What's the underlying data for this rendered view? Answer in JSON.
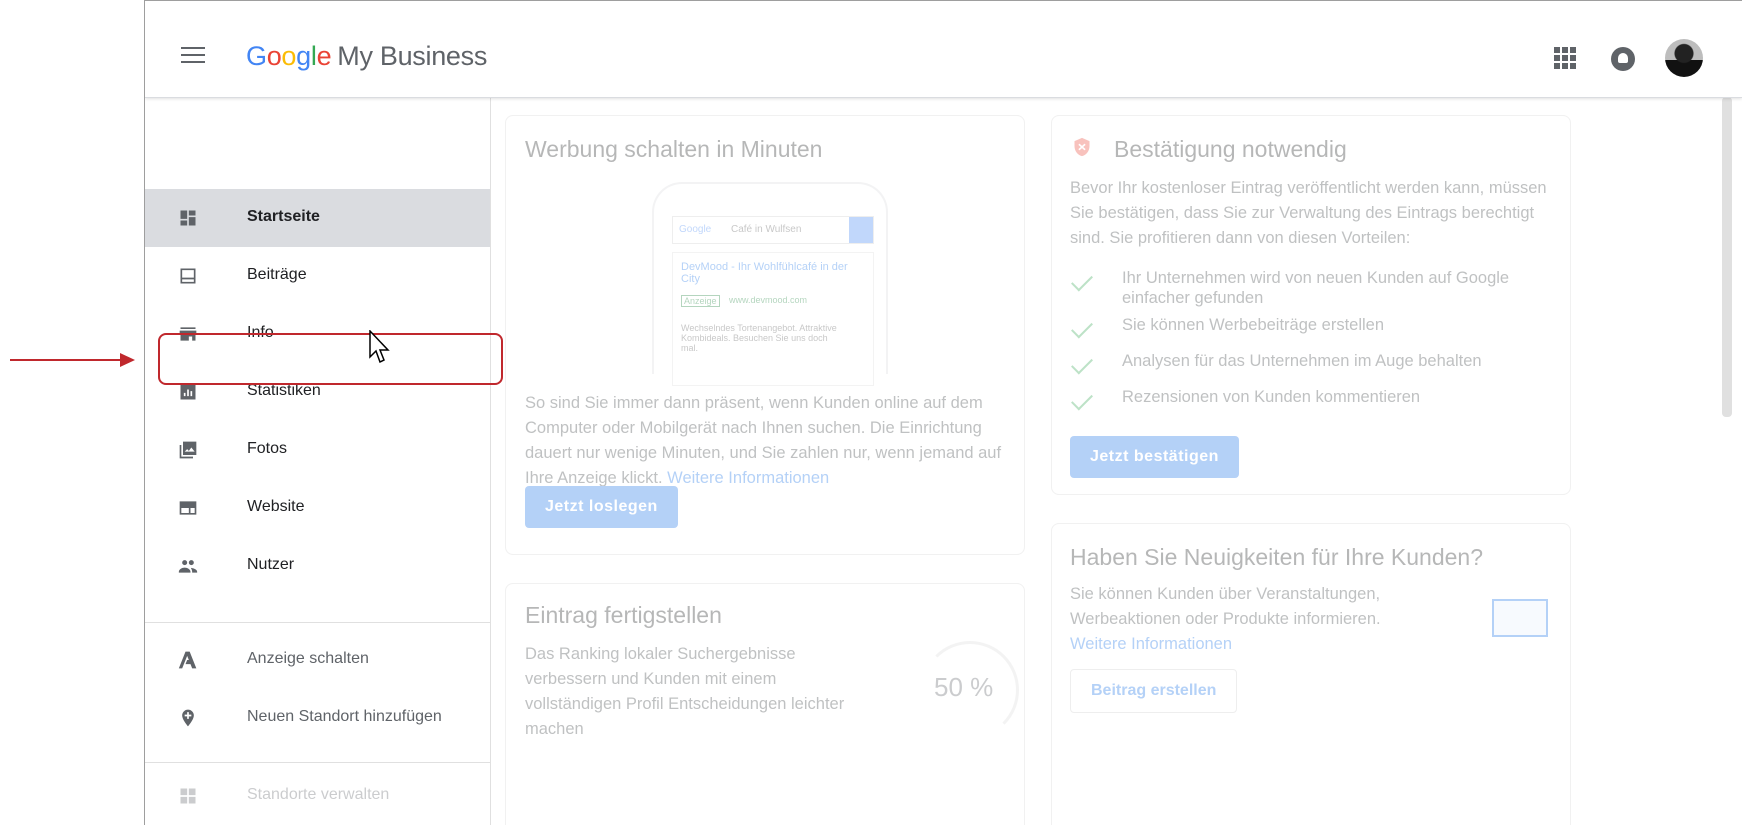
{
  "app": {
    "brand_google": [
      "G",
      "o",
      "o",
      "g",
      "l",
      "e"
    ],
    "brand_product": "My Business"
  },
  "sidebar": {
    "items": [
      {
        "label": "Startseite",
        "icon": "dashboard-icon",
        "active": true
      },
      {
        "label": "Beiträge",
        "icon": "posts-icon"
      },
      {
        "label": "Info",
        "icon": "storefront-icon"
      },
      {
        "label": "Statistiken",
        "icon": "insights-icon"
      },
      {
        "label": "Fotos",
        "icon": "photos-icon"
      },
      {
        "label": "Website",
        "icon": "website-icon"
      },
      {
        "label": "Nutzer",
        "icon": "users-icon"
      }
    ],
    "secondary": [
      {
        "label": "Anzeige schalten",
        "icon": "ads-icon"
      },
      {
        "label": "Neuen Standort hinzufügen",
        "icon": "add-location-icon"
      },
      {
        "label": "Standorte verwalten",
        "icon": "locations-icon"
      }
    ]
  },
  "cards": {
    "ads": {
      "title": "Werbung schalten in Minuten",
      "mock_search_label": "Google",
      "mock_search_query": "Café in Wulfsen",
      "mock_result_title": "DevMood - Ihr Wohlfühlcafé in der City",
      "mock_result_badge": "Anzeige",
      "mock_result_url": "www.devmood.com",
      "mock_result_text": "Wechselndes Tortenangebot. Attraktive Kombideals. Besuchen Sie uns doch mal.",
      "body": "So sind Sie immer dann präsent, wenn Kunden online auf dem Computer oder Mobilgerät nach Ihnen suchen. Die Einrichtung dauert nur wenige Minuten, und Sie zahlen nur, wenn jemand auf Ihre Anzeige klickt.",
      "link": "Weitere Informationen",
      "button": "Jetzt loslegen"
    },
    "verify": {
      "title": "Bestätigung notwendig",
      "body": "Bevor Ihr kostenloser Eintrag veröffentlicht werden kann, müssen Sie bestätigen, dass Sie zur Verwaltung des Eintrags berechtigt sind. Sie profitieren dann von diesen Vorteilen:",
      "benefits": [
        "Ihr Unternehmen wird von neuen Kunden auf Google einfacher gefunden",
        "Sie können Werbebeiträge erstellen",
        "Analysen für das Unternehmen im Auge behalten",
        "Rezensionen von Kunden kommentieren"
      ],
      "button": "Jetzt bestätigen"
    },
    "complete": {
      "title": "Eintrag fertigstellen",
      "body": "Das Ranking lokaler Suchergebnisse verbessern und Kunden mit einem vollständigen Profil Entscheidungen leichter machen",
      "progress": "50 %",
      "progress_value": 0.5
    },
    "news": {
      "title": "Haben Sie Neuigkeiten für Ihre Kunden?",
      "body": "Sie können Kunden über Veranstaltungen, Werbeaktionen oder Produkte informieren.",
      "link": "Weitere Informationen",
      "button": "Beitrag erstellen"
    }
  },
  "colors": {
    "accent": "#1a73e8",
    "annotation": "#c0282d",
    "active_nav": "#dadce0"
  }
}
